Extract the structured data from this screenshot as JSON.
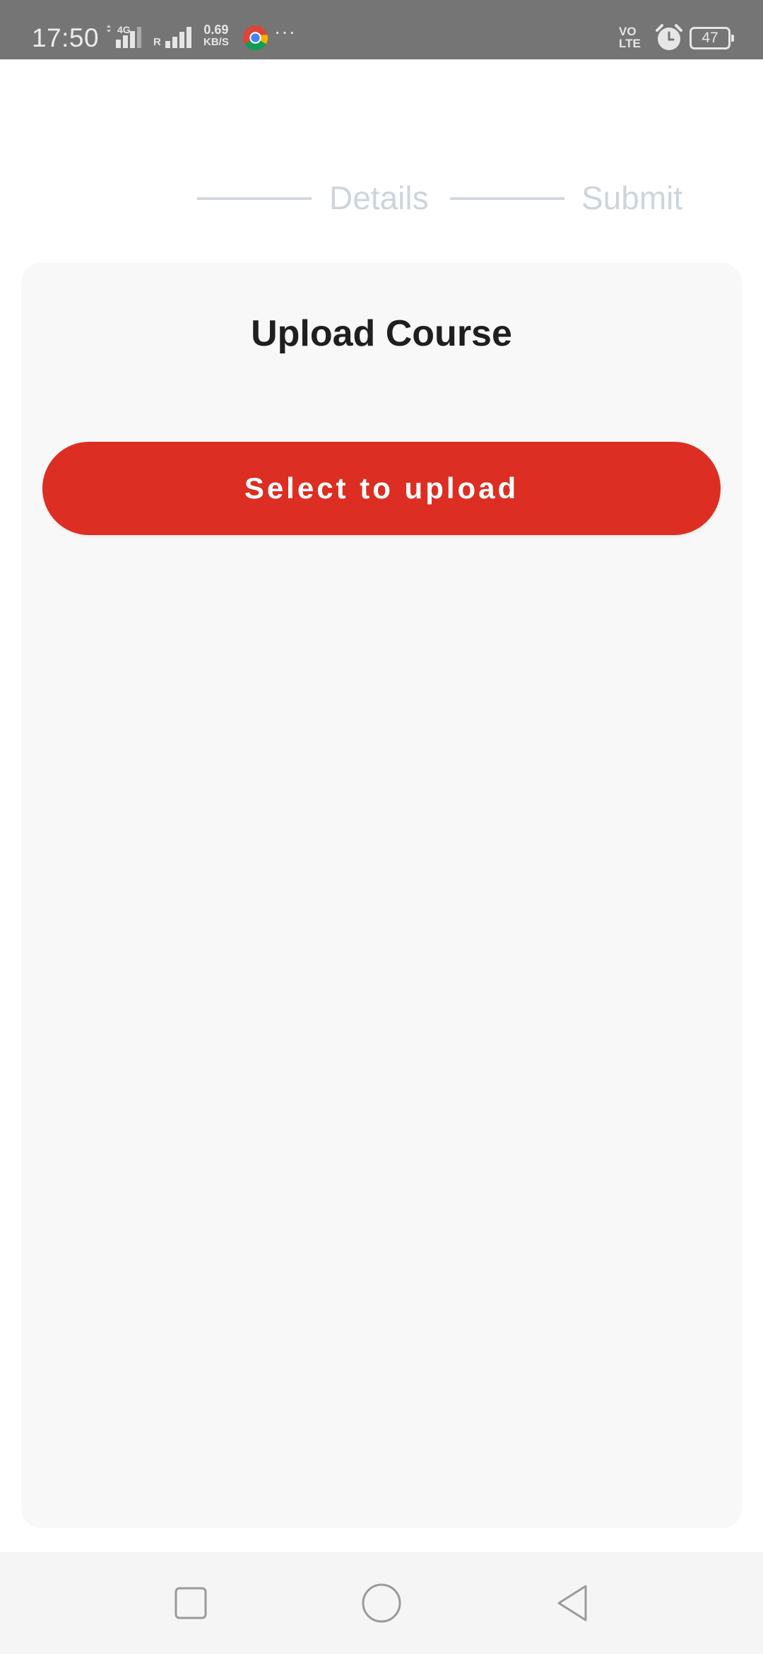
{
  "status_bar": {
    "time": "17:50",
    "network_type": "4G",
    "roaming_indicator": "R",
    "speed_value": "0.69",
    "speed_unit": "KB/S",
    "more_indicator": "···",
    "volte_line1": "VO",
    "volte_line2": "LTE",
    "battery_level": "47",
    "icons": [
      "signal-icon",
      "chrome-icon",
      "alarm-icon",
      "battery-icon"
    ]
  },
  "stepper": {
    "steps": [
      {
        "label": "Details"
      },
      {
        "label": "Submit"
      }
    ]
  },
  "card": {
    "title": "Upload Course",
    "upload_button_label": "Select to upload"
  },
  "colors": {
    "accent": "#dc2e22",
    "step_inactive": "#cdd5dc",
    "status_bar": "#757575"
  },
  "nav_bar": {
    "buttons": [
      "recent-apps",
      "home",
      "back"
    ]
  }
}
